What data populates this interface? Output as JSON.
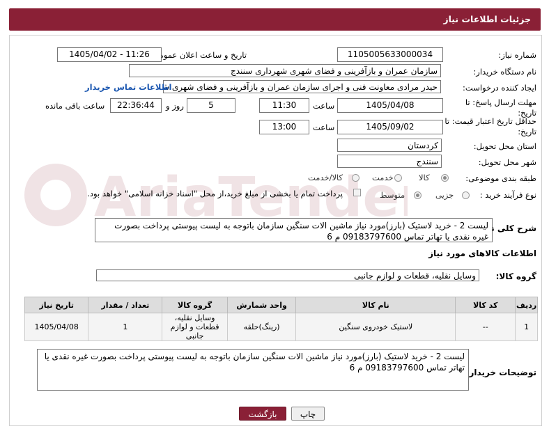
{
  "header": {
    "title": "جزئیات اطلاعات نیاز"
  },
  "fields": {
    "need_number_label": "شماره نیاز:",
    "need_number": "1105005633000034",
    "announce_label": "تاریخ و ساعت اعلان عمومی:",
    "announce_value": "1405/04/02 - 11:26",
    "buyer_org_label": "نام دستگاه خریدار:",
    "buyer_org": "سازمان عمران و بازآفرینی و فضای شهری شهرداری سنندج",
    "creator_label": "ایجاد کننده درخواست:",
    "creator": "حیدر مرادی معاونت فنی و اجرای سازمان عمران و بازآفرینی و فضای شهری شه",
    "contact_link": "اطلاعات تماس خریدار",
    "reply_deadline_label": "مهلت ارسال پاسخ: تا تاریخ:",
    "reply_date": "1405/04/08",
    "time_label": "ساعت",
    "reply_time": "11:30",
    "days_value": "5",
    "days_label": "روز و",
    "remaining_time": "22:36:44",
    "remaining_label": "ساعت باقی مانده",
    "price_validity_label": "حداقل تاریخ اعتبار قیمت: تا تاریخ:",
    "price_date": "1405/09/02",
    "price_time": "13:00",
    "province_label": "استان محل تحویل:",
    "province": "کردستان",
    "city_label": "شهر محل تحویل:",
    "city": "سنندج",
    "category_label": "طبقه بندی موضوعی:",
    "category_options": [
      "کالا",
      "خدمت",
      "کالا/خدمت"
    ],
    "process_label": "نوع فرآیند خرید :",
    "process_options": [
      "جزیی",
      "متوسط"
    ],
    "payment_note": "پرداخت تمام یا بخشی از مبلغ خرید،از محل \"اسناد خزانه اسلامی\" خواهد بود."
  },
  "description": {
    "label": "شرح کلی نیاز:",
    "text": "لیست 2 - خرید لاستیک (بارز)مورد نیاز ماشین الات سنگین سازمان باتوجه به لیست پیوستی پرداخت بصورت غیره نقدی یا تهاتر تماس 09183797600 م 6"
  },
  "goods_section": {
    "title": "اطلاعات کالاهای مورد نیاز",
    "group_label": "گروه کالا:",
    "group_value": "وسایل نقلیه، قطعات و لوازم جانبی"
  },
  "table": {
    "headers": [
      "ردیف",
      "کد کالا",
      "نام کالا",
      "واحد شمارش",
      "گروه کالا",
      "تعداد / مقدار",
      "تاریخ نیاز"
    ],
    "rows": [
      [
        "1",
        "--",
        "لاستیک خودروی سنگین",
        "(رینگ)حلقه",
        "وسایل نقلیه، قطعات و لوازم جانبی",
        "1",
        "1405/04/08"
      ]
    ]
  },
  "buyer_notes": {
    "label": "توضیحات خریدار:",
    "text": "لیست 2 - خرید لاستیک (بارز)مورد نیاز ماشین الات سنگین سازمان باتوجه به لیست پیوستی پرداخت بصورت غیره نقدی یا تهاتر تماس 09183797600 م 6"
  },
  "buttons": {
    "print": "چاپ",
    "back": "بازگشت"
  },
  "colors": {
    "header_bg": "#8a2036",
    "link": "#1a56b0",
    "back_button_bg": "#8a2036"
  }
}
